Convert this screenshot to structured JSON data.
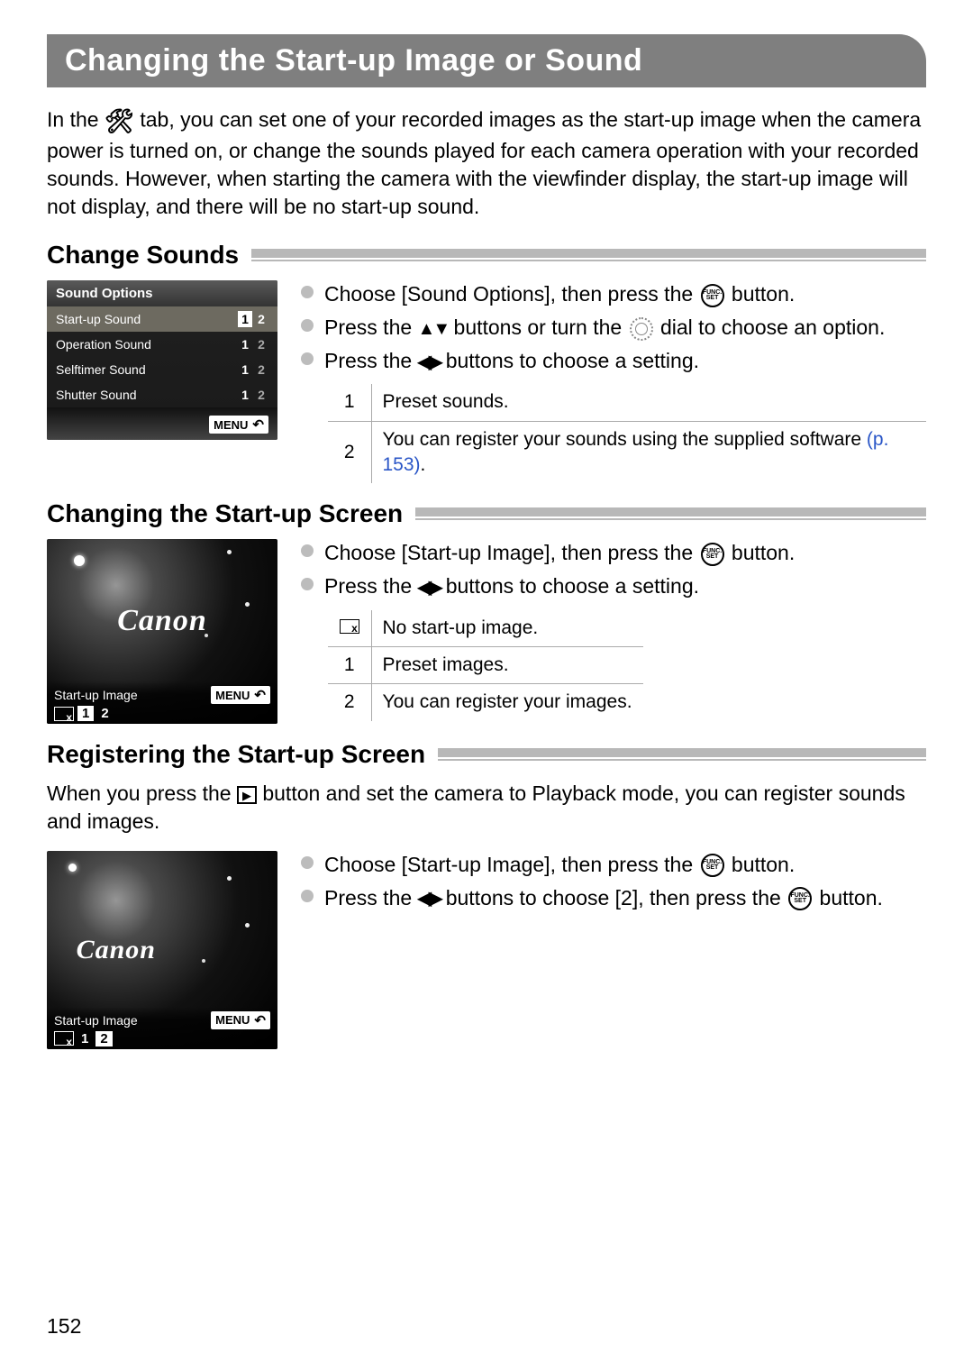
{
  "title": "Changing the Start-up Image or Sound",
  "intro_a": "In the ",
  "intro_b": " tab, you can set one of your recorded images as the start-up image when the camera power is turned on, or change the sounds played for each camera operation with your recorded sounds. However, when starting the camera with the viewfinder display, the start-up image will not display, and there will be no start-up sound.",
  "sec1": {
    "heading": "Change Sounds",
    "lcd_title": "Sound Options",
    "rows": [
      {
        "label": "Start-up Sound",
        "v1": "1",
        "v2": "2"
      },
      {
        "label": "Operation Sound",
        "v1": "1",
        "v2": "2"
      },
      {
        "label": "Selftimer Sound",
        "v1": "1",
        "v2": "2"
      },
      {
        "label": "Shutter Sound",
        "v1": "1",
        "v2": "2"
      }
    ],
    "menu": "MENU",
    "b1a": "Choose [Sound Options], then press the ",
    "b1b": " button.",
    "b2a": "Press the ",
    "b2b": " buttons or turn the ",
    "b2c": " dial to choose an option.",
    "b3a": "Press the ",
    "b3b": " buttons to choose a setting.",
    "t1_n": "1",
    "t1_t": "Preset sounds.",
    "t2_n": "2",
    "t2_ta": "You can register your sounds using the supplied software ",
    "t2_tb": "(p. 153)",
    "t2_tc": "."
  },
  "sec2": {
    "heading": "Changing the Start-up Screen",
    "canon": "Canon",
    "start_label": "Start-up Image",
    "menu": "MENU",
    "opt1": "1",
    "opt2": "2",
    "b1a": "Choose [Start-up Image], then press the ",
    "b1b": " button.",
    "b2a": "Press the ",
    "b2b": " buttons to choose a setting.",
    "t1_t": "No start-up image.",
    "t2_n": "1",
    "t2_t": "Preset images.",
    "t3_n": "2",
    "t3_t": "You can register your images."
  },
  "sec3": {
    "heading": "Registering the Start-up Screen",
    "intro_a": "When you press the ",
    "intro_b": " button and set the camera to Playback mode, you can register sounds and images.",
    "canon": "Canon",
    "start_label": "Start-up Image",
    "menu": "MENU",
    "opt1": "1",
    "opt2": "2",
    "b1a": "Choose [Start-up Image], then press the ",
    "b1b": " button.",
    "b2a": "Press the ",
    "b2b": " buttons to choose [2], then press the ",
    "b2c": " button."
  },
  "page_num": "152"
}
